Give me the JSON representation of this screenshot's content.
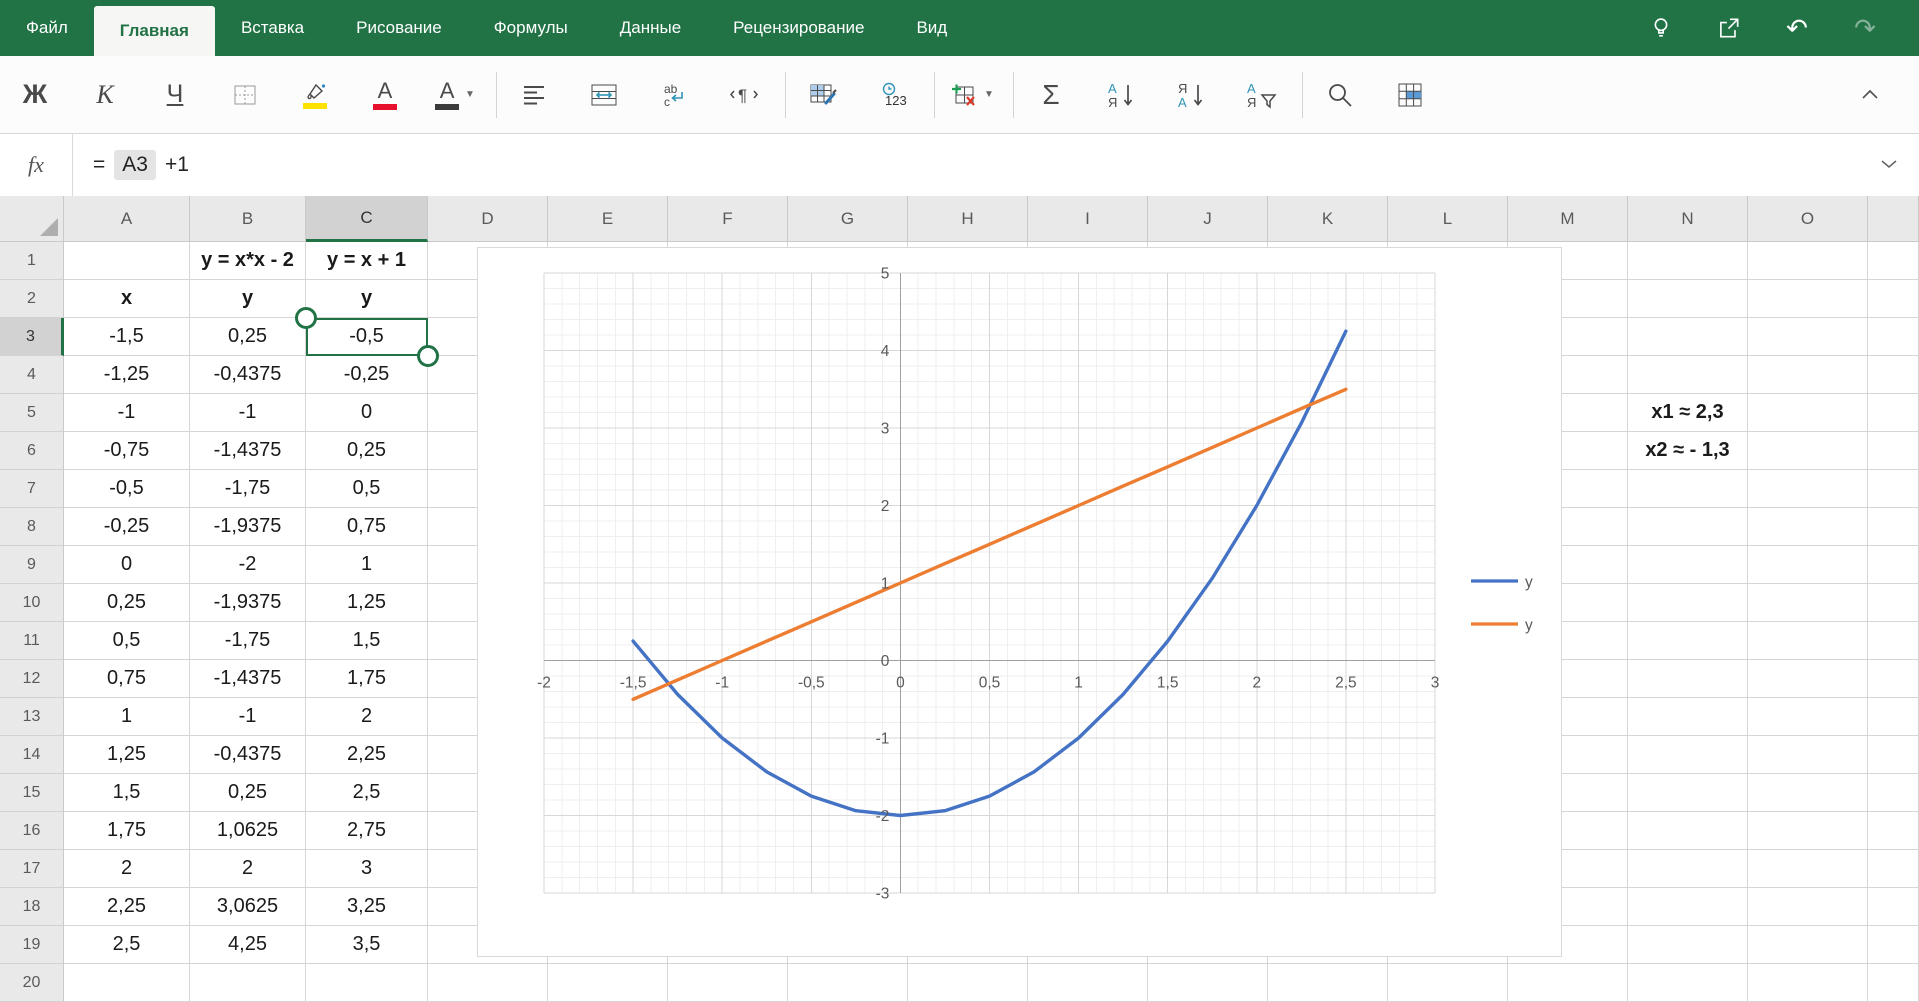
{
  "app": {
    "accent_green": "#217346",
    "series_blue": "#4472C4",
    "series_orange": "#ED7D31"
  },
  "tabbar": {
    "tabs": [
      {
        "label": "Файл",
        "active": false
      },
      {
        "label": "Главная",
        "active": true
      },
      {
        "label": "Вставка",
        "active": false
      },
      {
        "label": "Рисование",
        "active": false
      },
      {
        "label": "Формулы",
        "active": false
      },
      {
        "label": "Данные",
        "active": false
      },
      {
        "label": "Рецензирование",
        "active": false
      },
      {
        "label": "Вид",
        "active": false
      }
    ],
    "right_icons": [
      {
        "name": "lightbulb-icon",
        "dimmed": false
      },
      {
        "name": "share-icon",
        "dimmed": false
      },
      {
        "name": "undo-icon",
        "glyph": "↶",
        "dimmed": false
      },
      {
        "name": "redo-icon",
        "glyph": "↷",
        "dimmed": true
      }
    ]
  },
  "toolbar": {
    "items": [
      {
        "name": "bold-button",
        "type": "glyph",
        "glyph": "Ж",
        "cls": "g-bold"
      },
      {
        "name": "italic-button",
        "type": "glyph",
        "glyph": "К",
        "cls": "g-italic"
      },
      {
        "name": "underline-button",
        "type": "glyph",
        "glyph": "Ч",
        "cls": "g-underline"
      },
      {
        "name": "borders-button",
        "type": "icon",
        "icon": "borders"
      },
      {
        "name": "fill-color-button",
        "type": "icon",
        "icon": "fill-color",
        "color": "#ffe100"
      },
      {
        "name": "font-color-button",
        "type": "icon",
        "icon": "font-color",
        "glyph": "А",
        "color": "#e8112d"
      },
      {
        "name": "format-options-button",
        "type": "icon",
        "icon": "text-format",
        "glyph": "A",
        "color": "#3b3b3b",
        "caret": true
      },
      {
        "type": "sep"
      },
      {
        "name": "align-left-button",
        "type": "icon",
        "icon": "align-left"
      },
      {
        "name": "merge-cells-button",
        "type": "icon",
        "icon": "merge-cells"
      },
      {
        "name": "wrap-text-button",
        "type": "icon",
        "icon": "wrap-text",
        "glyph": "abc"
      },
      {
        "name": "paragraph-button",
        "type": "icon",
        "icon": "paragraph",
        "glyph": "¶"
      },
      {
        "type": "sep"
      },
      {
        "name": "format-table-button",
        "type": "icon",
        "icon": "format-table"
      },
      {
        "name": "number-format-button",
        "type": "icon",
        "icon": "number-format",
        "glyph": "123"
      },
      {
        "type": "sep"
      },
      {
        "name": "insert-delete-cells-button",
        "type": "icon",
        "icon": "insert-cells",
        "caret": true
      },
      {
        "type": "sep"
      },
      {
        "name": "autosum-button",
        "type": "glyph",
        "glyph": "Σ",
        "cls": "g-sigma"
      },
      {
        "name": "sort-asc-button",
        "type": "icon",
        "icon": "sort-asc",
        "glyph": "АЯ"
      },
      {
        "name": "sort-desc-button",
        "type": "icon",
        "icon": "sort-desc",
        "glyph": "ЯА"
      },
      {
        "name": "filter-button",
        "type": "icon",
        "icon": "filter",
        "glyph": "АЯ"
      },
      {
        "type": "sep"
      },
      {
        "name": "search-button",
        "type": "icon",
        "icon": "search"
      },
      {
        "name": "freeze-panes-button",
        "type": "icon",
        "icon": "freeze-panes"
      }
    ]
  },
  "formula_bar": {
    "fx_label": "fx",
    "tokens": [
      {
        "text": "=",
        "highlight": false
      },
      {
        "text": "A3",
        "highlight": true
      },
      {
        "text": "+1",
        "highlight": false
      }
    ]
  },
  "sheet": {
    "column_headers": [
      "A",
      "B",
      "C",
      "D",
      "E",
      "F",
      "G",
      "H",
      "I",
      "J",
      "K",
      "L",
      "M",
      "N",
      "O",
      ""
    ],
    "selected": {
      "cell": "C3",
      "column": "C",
      "row": 3
    },
    "rows": [
      {
        "n": 1,
        "cells": {
          "B": "y = x*x - 2",
          "C": "y = x + 1"
        },
        "bold": [
          "B",
          "C"
        ]
      },
      {
        "n": 2,
        "cells": {
          "A": "x",
          "B": "y",
          "C": "y"
        },
        "bold": [
          "A",
          "B",
          "C"
        ]
      },
      {
        "n": 3,
        "cells": {
          "A": "-1,5",
          "B": "0,25",
          "C": "-0,5"
        },
        "bold": []
      },
      {
        "n": 4,
        "cells": {
          "A": "-1,25",
          "B": "-0,4375",
          "C": "-0,25"
        },
        "bold": []
      },
      {
        "n": 5,
        "cells": {
          "A": "-1",
          "B": "-1",
          "C": "0",
          "N": "x1 ≈ 2,3"
        },
        "bold": [
          "N"
        ]
      },
      {
        "n": 6,
        "cells": {
          "A": "-0,75",
          "B": "-1,4375",
          "C": "0,25",
          "N": "x2 ≈ - 1,3"
        },
        "bold": [
          "N"
        ]
      },
      {
        "n": 7,
        "cells": {
          "A": "-0,5",
          "B": "-1,75",
          "C": "0,5"
        },
        "bold": []
      },
      {
        "n": 8,
        "cells": {
          "A": "-0,25",
          "B": "-1,9375",
          "C": "0,75"
        },
        "bold": []
      },
      {
        "n": 9,
        "cells": {
          "A": "0",
          "B": "-2",
          "C": "1"
        },
        "bold": []
      },
      {
        "n": 10,
        "cells": {
          "A": "0,25",
          "B": "-1,9375",
          "C": "1,25"
        },
        "bold": []
      },
      {
        "n": 11,
        "cells": {
          "A": "0,5",
          "B": "-1,75",
          "C": "1,5"
        },
        "bold": []
      },
      {
        "n": 12,
        "cells": {
          "A": "0,75",
          "B": "-1,4375",
          "C": "1,75"
        },
        "bold": []
      },
      {
        "n": 13,
        "cells": {
          "A": "1",
          "B": "-1",
          "C": "2"
        },
        "bold": []
      },
      {
        "n": 14,
        "cells": {
          "A": "1,25",
          "B": "-0,4375",
          "C": "2,25"
        },
        "bold": []
      },
      {
        "n": 15,
        "cells": {
          "A": "1,5",
          "B": "0,25",
          "C": "2,5"
        },
        "bold": []
      },
      {
        "n": 16,
        "cells": {
          "A": "1,75",
          "B": "1,0625",
          "C": "2,75"
        },
        "bold": []
      },
      {
        "n": 17,
        "cells": {
          "A": "2",
          "B": "2",
          "C": "3"
        },
        "bold": []
      },
      {
        "n": 18,
        "cells": {
          "A": "2,25",
          "B": "3,0625",
          "C": "3,25"
        },
        "bold": []
      },
      {
        "n": 19,
        "cells": {
          "A": "2,5",
          "B": "4,25",
          "C": "3,5"
        },
        "bold": []
      },
      {
        "n": 20,
        "cells": {},
        "bold": []
      }
    ]
  },
  "chart_data": {
    "type": "line",
    "title": "",
    "xlabel": "",
    "ylabel": "",
    "x": [
      -1.5,
      -1.25,
      -1,
      -0.75,
      -0.5,
      -0.25,
      0,
      0.25,
      0.5,
      0.75,
      1,
      1.25,
      1.5,
      1.75,
      2,
      2.25,
      2.5
    ],
    "series": [
      {
        "name": "y",
        "color": "#4472C4",
        "values": [
          0.25,
          -0.4375,
          -1,
          -1.4375,
          -1.75,
          -1.9375,
          -2,
          -1.9375,
          -1.75,
          -1.4375,
          -1,
          -0.4375,
          0.25,
          1.0625,
          2,
          3.0625,
          4.25
        ]
      },
      {
        "name": "y",
        "color": "#ED7D31",
        "values": [
          -0.5,
          -0.25,
          0,
          0.25,
          0.5,
          0.75,
          1,
          1.25,
          1.5,
          1.75,
          2,
          2.25,
          2.5,
          2.75,
          3,
          3.25,
          3.5
        ]
      }
    ],
    "xlim": [
      -2,
      3
    ],
    "ylim": [
      -3,
      5
    ],
    "x_major": 0.5,
    "x_minor": 0.1,
    "y_major": 1,
    "y_minor": 0.2,
    "x_tick_labels": [
      "-2",
      "-1,5",
      "-1",
      "-0,5",
      "0",
      "0,5",
      "1",
      "1,5",
      "2",
      "2,5",
      "3"
    ],
    "y_tick_labels": [
      "5",
      "4",
      "3",
      "2",
      "1",
      "0",
      "-1",
      "-2",
      "-3"
    ],
    "grid": true,
    "legend": [
      "y",
      "y"
    ],
    "legend_position": "right"
  }
}
